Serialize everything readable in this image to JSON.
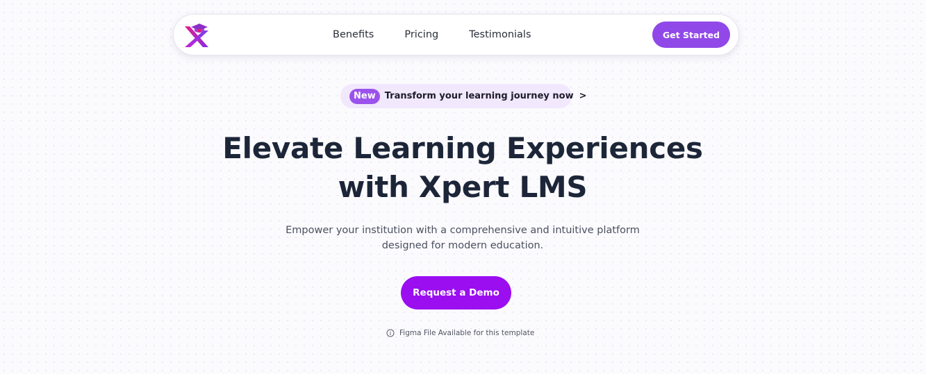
{
  "navbar": {
    "logo_icon": "xpert-graduation-cap-logo",
    "links": [
      "Benefits",
      "Pricing",
      "Testimonials"
    ],
    "cta_label": "Get Started"
  },
  "announcement": {
    "badge": "New",
    "text": "Transform your learning journey now",
    "chevron": ">"
  },
  "hero": {
    "title_line1": "Elevate Learning Experiences",
    "title_line2": "with Xpert LMS",
    "subtitle_line1": "Empower your institution with a comprehensive and intuitive platform",
    "subtitle_line2": "designed for modern education.",
    "cta_label": "Request a Demo"
  },
  "footer_note": {
    "icon": "info-circle-icon",
    "text": "Figma File Available for this template"
  },
  "colors": {
    "accent": "#9148e8",
    "demo_button": "#9a0ef0",
    "badge": "#9b52ec",
    "announcement_bg": "#f1e8fd",
    "heading": "#1c2638",
    "background": "#fbfafd"
  }
}
